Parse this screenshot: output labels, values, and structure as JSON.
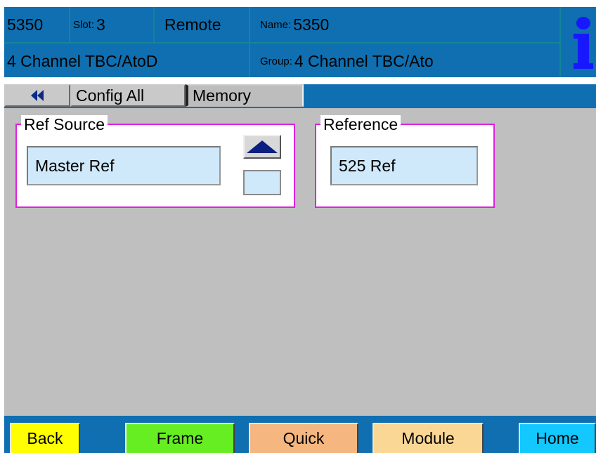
{
  "header": {
    "model": "5350",
    "slot_label": "Slot:",
    "slot_value": "3",
    "mode": "Remote",
    "name_label": "Name:",
    "name_value": "5350",
    "description": "4 Channel TBC/AtoD",
    "group_label": "Group:",
    "group_value": "4 Channel TBC/Ato",
    "info_icon": "info-icon"
  },
  "tabs": {
    "back_icon": "double-left-arrow-icon",
    "items": [
      {
        "label": "Config All",
        "active": false
      },
      {
        "label": "Memory",
        "active": true
      }
    ]
  },
  "ref_source": {
    "legend": "Ref Source",
    "value": "Master Ref",
    "up_icon": "up-arrow-icon"
  },
  "reference": {
    "legend": "Reference",
    "value": "525 Ref"
  },
  "footer": {
    "buttons": [
      {
        "label": "Back",
        "color": "#ffff00"
      },
      {
        "label": "Frame",
        "color": "#66ee22"
      },
      {
        "label": "Quick",
        "color": "#f5b67f"
      },
      {
        "label": "Module",
        "color": "#fbd796"
      },
      {
        "label": "Home",
        "color": "#12c8ff"
      }
    ]
  },
  "colors": {
    "header_bg": "#0f6fb0",
    "content_bg": "#bfbfbf",
    "group_border": "#e020e0",
    "field_bg": "#cfe9fb"
  }
}
